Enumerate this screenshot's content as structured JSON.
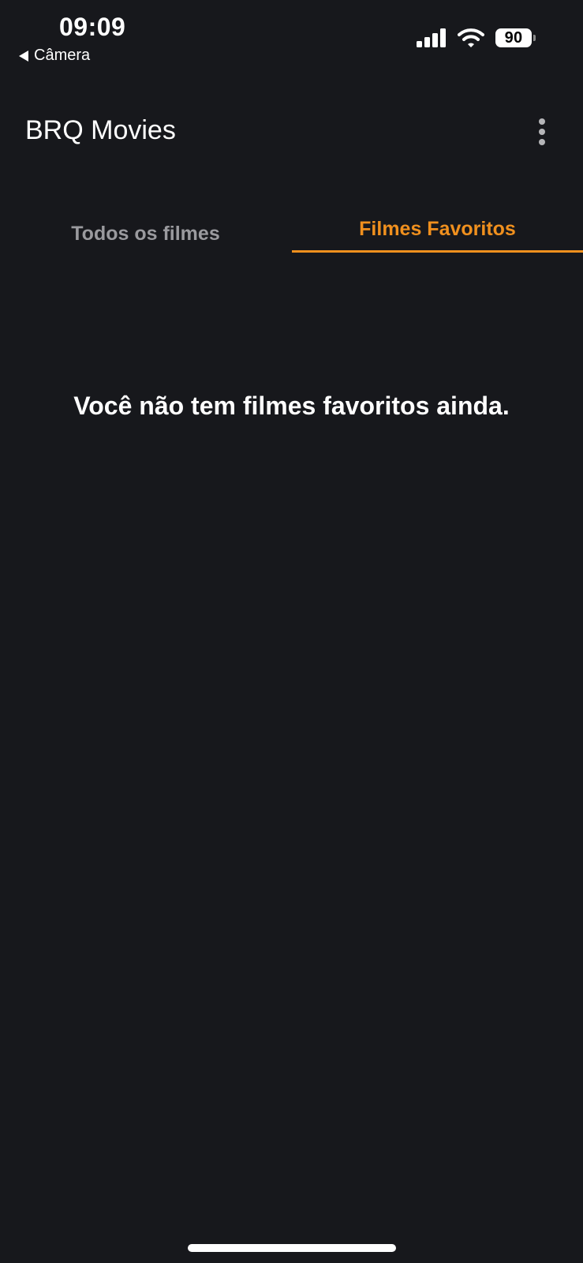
{
  "status_bar": {
    "time": "09:09",
    "back_label": "Câmera",
    "battery_level": "90",
    "icons": [
      "signal-icon",
      "wifi-icon",
      "battery-icon"
    ]
  },
  "app_bar": {
    "title": "BRQ Movies",
    "menu_icon": "more-vertical-icon"
  },
  "tabs": [
    {
      "label": "Todos os filmes",
      "selected": false
    },
    {
      "label": "Filmes Favoritos",
      "selected": true
    }
  ],
  "main": {
    "empty_message": "Você não tem filmes favoritos ainda."
  },
  "colors": {
    "background": "#17181c",
    "accent": "#f0901e",
    "tab_inactive": "#9a9a9e",
    "text": "#ffffff"
  }
}
